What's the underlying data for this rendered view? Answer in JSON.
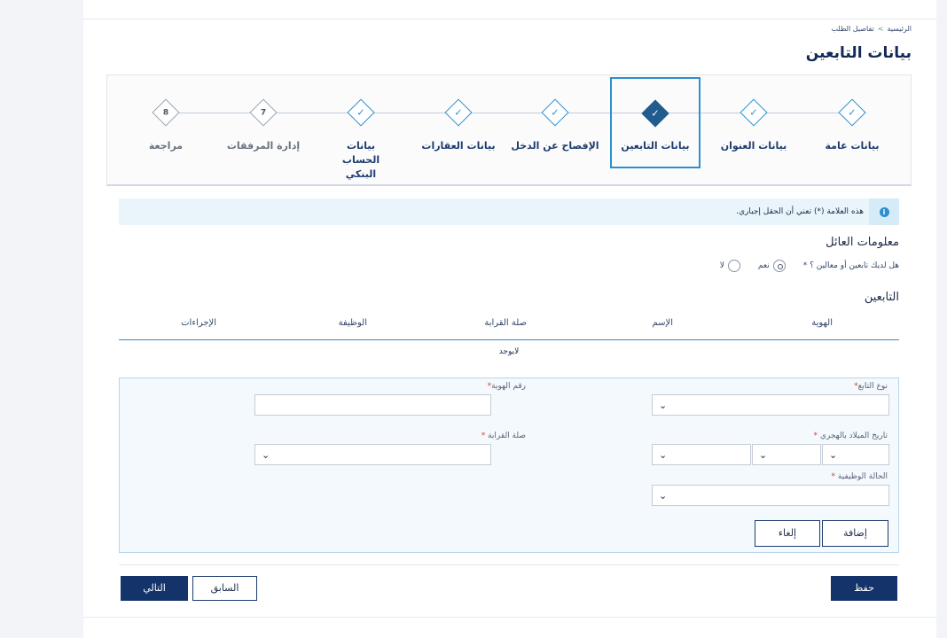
{
  "breadcrumb": {
    "home": "الرئيسية",
    "separator": ">",
    "current": "تفاصيل الطلب"
  },
  "page_title": "بيانات التابعين",
  "steps": [
    {
      "label": "بيانات عامة",
      "status": "done"
    },
    {
      "label": "بيانات العنوان",
      "status": "done"
    },
    {
      "label": "بيانات التابعين",
      "status": "active"
    },
    {
      "label": "الإفصاح عن الدخل",
      "status": "done"
    },
    {
      "label": "بيانات العقارات",
      "status": "done"
    },
    {
      "label": "بيانات الحساب البنكي",
      "status": "done"
    },
    {
      "label": "إدارة المرفقات",
      "status": "pending",
      "number": "7"
    },
    {
      "label": "مراجعة",
      "status": "pending",
      "number": "8"
    }
  ],
  "info": {
    "text": "هذه العلامة (*) تعني أن الحقل إجباري.",
    "icon": "info-icon"
  },
  "family_section": {
    "title": "معلومات العائل",
    "question": "هل لديك تابعين أو معالين ؟ *",
    "options": {
      "yes": "نعم",
      "no": "لا",
      "selected": "yes"
    }
  },
  "dependents": {
    "title": "التابعين",
    "columns": {
      "id": "الهوية",
      "name": "الإسم",
      "relation": "صلة القرابة",
      "job": "الوظيفة",
      "actions": "الإجراءات"
    },
    "empty": "لايوجد"
  },
  "form": {
    "dependent_type": "نوع التابع",
    "id_number": "رقم الهوية",
    "hijri_birth_date": "تاريخ الميلاد بالهجري",
    "relation": "صلة القرابة",
    "employment_status": "الحالة الوظيفية",
    "required_mark": "*",
    "add_label": "إضافة",
    "cancel_label": "إلغاء"
  },
  "footer": {
    "save_label": "حفظ",
    "previous_label": "السابق",
    "next_label": "التالي"
  },
  "colors": {
    "primary": "#13336a",
    "accent": "#2c8fcf",
    "info_bg": "#e9f4fb",
    "form_bg": "#f4f9fd",
    "required": "#d63b3b"
  }
}
